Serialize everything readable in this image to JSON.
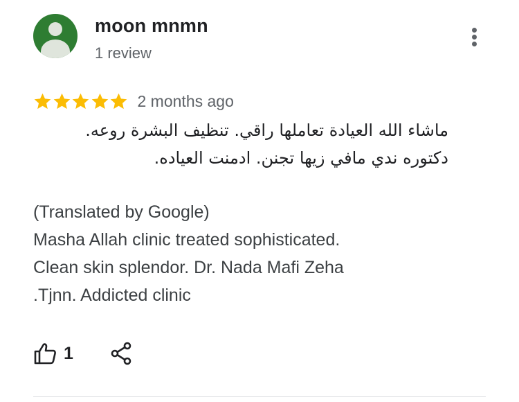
{
  "review": {
    "author_name": "moon mnmn",
    "review_count": "1 review",
    "rating": 5,
    "rating_max": 5,
    "date": "2 months ago",
    "original_text_line1": "ماشاء الله العيادة تعاملها راقي. تنظيف البشرة روعه.",
    "original_text_line2": "دكتوره ندي مافي زيها تجنن. ادمنت العياده.",
    "translated_by": "(Translated by Google)",
    "translation_lines": [
      "Masha Allah clinic treated sophisticated.",
      "Clean skin splendor. Dr. Nada Mafi Zeha",
      ".Tjnn. Addicted clinic"
    ],
    "like_count": "1"
  },
  "icons": {
    "avatar": "person-avatar-icon",
    "more": "more-vert-icon",
    "star": "star-icon",
    "like": "thumb-up-icon",
    "share": "share-icon"
  },
  "colors": {
    "avatar_bg": "#2e7d32",
    "star": "#fbbc04",
    "text_primary": "#202124",
    "text_secondary": "#5f6368"
  }
}
